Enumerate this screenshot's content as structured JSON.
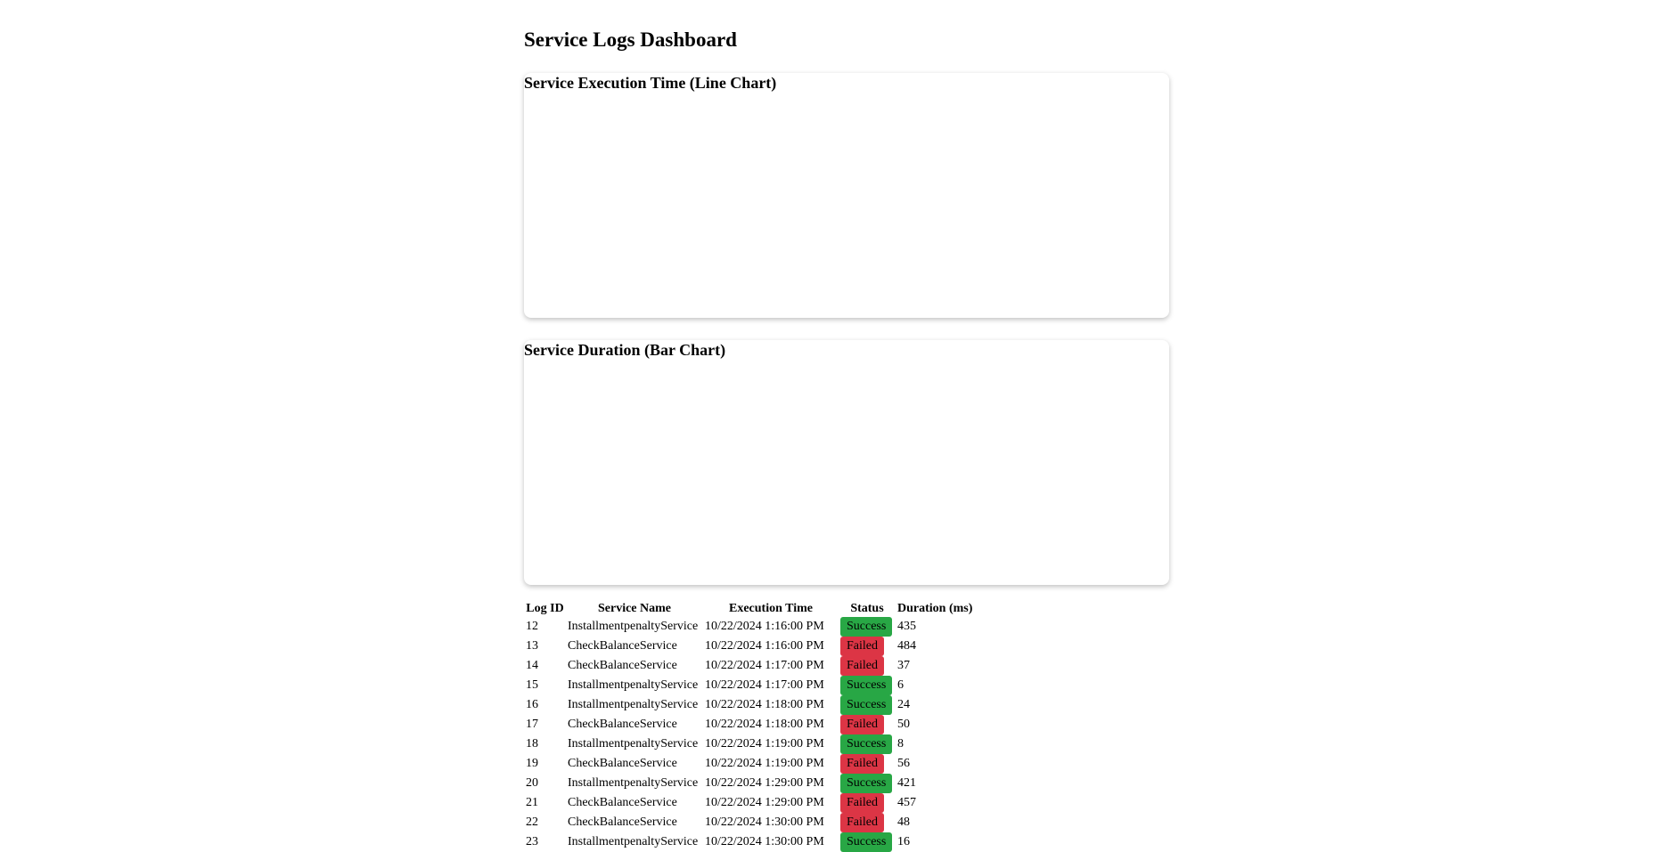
{
  "page": {
    "title": "Service Logs Dashboard"
  },
  "charts": {
    "line_title": "Service Execution Time (Line Chart)",
    "bar_title": "Service Duration (Bar Chart)"
  },
  "colors": {
    "success": "#28a745",
    "failed": "#dc3545"
  },
  "table": {
    "headers": {
      "log_id": "Log ID",
      "service_name": "Service Name",
      "execution_time": "Execution Time",
      "status": "Status",
      "duration": "Duration (ms)"
    },
    "rows": [
      {
        "log_id": "12",
        "service_name": "InstallmentpenaltyService",
        "execution_time": "10/22/2024 1:16:00 PM",
        "status": "Success",
        "duration": "435"
      },
      {
        "log_id": "13",
        "service_name": "CheckBalanceService",
        "execution_time": "10/22/2024 1:16:00 PM",
        "status": "Failed",
        "duration": "484"
      },
      {
        "log_id": "14",
        "service_name": "CheckBalanceService",
        "execution_time": "10/22/2024 1:17:00 PM",
        "status": "Failed",
        "duration": "37"
      },
      {
        "log_id": "15",
        "service_name": "InstallmentpenaltyService",
        "execution_time": "10/22/2024 1:17:00 PM",
        "status": "Success",
        "duration": "6"
      },
      {
        "log_id": "16",
        "service_name": "InstallmentpenaltyService",
        "execution_time": "10/22/2024 1:18:00 PM",
        "status": "Success",
        "duration": "24"
      },
      {
        "log_id": "17",
        "service_name": "CheckBalanceService",
        "execution_time": "10/22/2024 1:18:00 PM",
        "status": "Failed",
        "duration": "50"
      },
      {
        "log_id": "18",
        "service_name": "InstallmentpenaltyService",
        "execution_time": "10/22/2024 1:19:00 PM",
        "status": "Success",
        "duration": "8"
      },
      {
        "log_id": "19",
        "service_name": "CheckBalanceService",
        "execution_time": "10/22/2024 1:19:00 PM",
        "status": "Failed",
        "duration": "56"
      },
      {
        "log_id": "20",
        "service_name": "InstallmentpenaltyService",
        "execution_time": "10/22/2024 1:29:00 PM",
        "status": "Success",
        "duration": "421"
      },
      {
        "log_id": "21",
        "service_name": "CheckBalanceService",
        "execution_time": "10/22/2024 1:29:00 PM",
        "status": "Failed",
        "duration": "457"
      },
      {
        "log_id": "22",
        "service_name": "CheckBalanceService",
        "execution_time": "10/22/2024 1:30:00 PM",
        "status": "Failed",
        "duration": "48"
      },
      {
        "log_id": "23",
        "service_name": "InstallmentpenaltyService",
        "execution_time": "10/22/2024 1:30:00 PM",
        "status": "Success",
        "duration": "16"
      }
    ]
  }
}
